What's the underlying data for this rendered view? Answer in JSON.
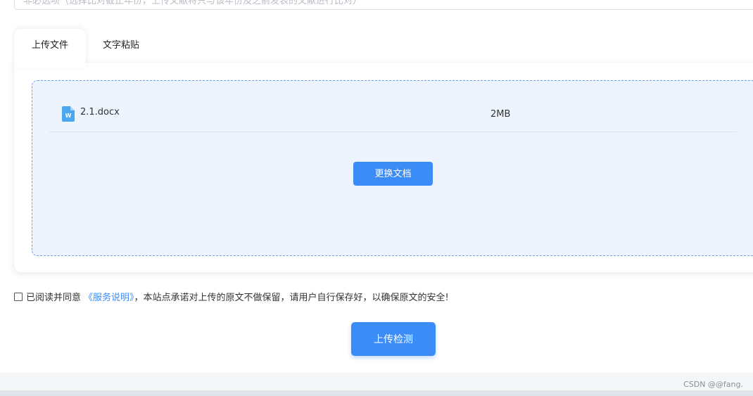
{
  "filter_input": {
    "value": "非必选项（选择比对截止年份，上传文献将只与该年份及之前发表的文献进行比对）"
  },
  "tabs": [
    {
      "label": "上传文件",
      "active": true
    },
    {
      "label": "文字粘贴",
      "active": false
    }
  ],
  "file": {
    "icon": "word-doc-icon",
    "name": "2.1.docx",
    "size": "2MB"
  },
  "replace_button": {
    "label": "更换文档"
  },
  "agreement": {
    "checked": false,
    "prefix": "已阅读并同意",
    "link": "《服务说明》",
    "suffix": "，本站点承诺对上传的原文不做保留，请用户自行保存好，以确保原文的安全!"
  },
  "upload_button": {
    "label": "上传检测"
  },
  "watermark": "CSDN @@fang.",
  "colors": {
    "accent": "#3c8cf7",
    "dropzone_bg": "#eef4fd",
    "dropzone_border": "#6ea1e8",
    "file_icon": "#4aa8f0"
  }
}
